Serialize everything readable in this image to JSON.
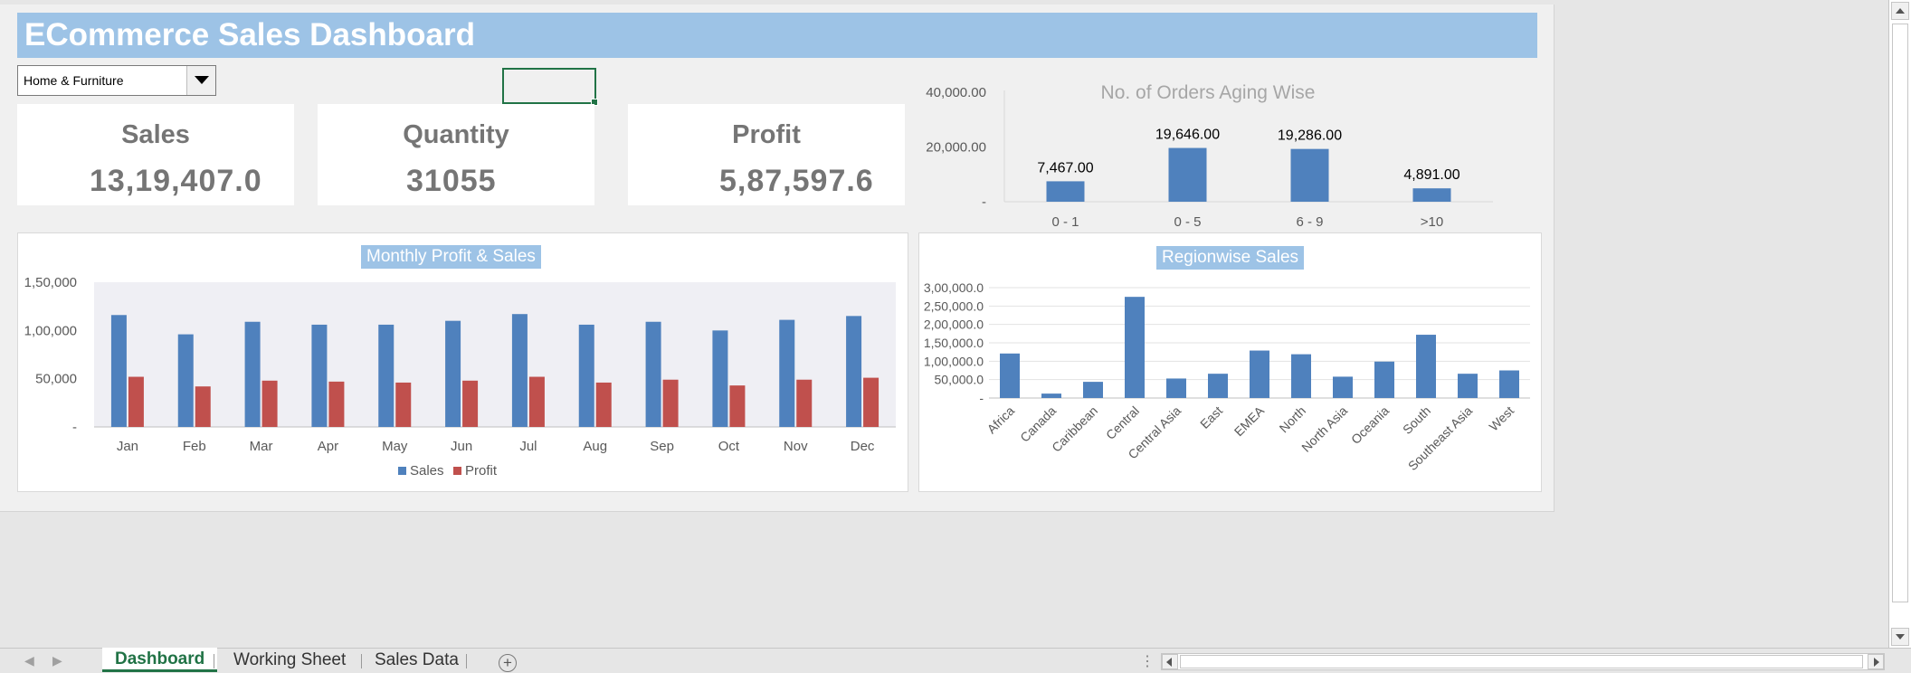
{
  "dashboard": {
    "title": "ECommerce Sales Dashboard",
    "filter": {
      "selected": "Home & Furniture"
    }
  },
  "kpis": [
    {
      "label": "Sales",
      "value": "13,19,407.0"
    },
    {
      "label": "Quantity",
      "value": "31055"
    },
    {
      "label": "Profit",
      "value": "5,87,597.6"
    }
  ],
  "colors": {
    "banner": "#9dc3e6",
    "sales": "#4f81bd",
    "profit": "#c0504d",
    "selection": "#217346"
  },
  "chart_data": [
    {
      "id": "aging",
      "type": "bar",
      "title": "No. of Orders Aging Wise",
      "categories": [
        "0 - 1",
        "0 - 5",
        "6 - 9",
        ">10"
      ],
      "values": [
        7467,
        19646,
        19286,
        4891
      ],
      "value_labels": [
        "7,467.00",
        "19,646.00",
        "19,286.00",
        "4,891.00"
      ],
      "y_ticks": [
        "-",
        "20,000.00",
        "40,000.00"
      ],
      "ylim": [
        0,
        40000
      ],
      "grid": false
    },
    {
      "id": "monthly",
      "type": "bar",
      "title": "Monthly Profit & Sales",
      "categories": [
        "Jan",
        "Feb",
        "Mar",
        "Apr",
        "May",
        "Jun",
        "Jul",
        "Aug",
        "Sep",
        "Oct",
        "Nov",
        "Dec"
      ],
      "series": [
        {
          "name": "Sales",
          "values": [
            116000,
            96000,
            109000,
            106000,
            106000,
            110000,
            117000,
            106000,
            109000,
            100000,
            111000,
            115000
          ]
        },
        {
          "name": "Profit",
          "values": [
            52000,
            42000,
            48000,
            47000,
            46000,
            48000,
            52000,
            46000,
            49000,
            43000,
            49000,
            51000
          ]
        }
      ],
      "y_ticks": [
        "-",
        "50,000",
        "1,00,000",
        "1,50,000"
      ],
      "ylim": [
        0,
        150000
      ],
      "legend": "bottom"
    },
    {
      "id": "region",
      "type": "bar",
      "title": "Regionwise Sales",
      "categories": [
        "Africa",
        "Canada",
        "Caribbean",
        "Central",
        "Central Asia",
        "East",
        "EMEA",
        "North",
        "North Asia",
        "Oceania",
        "South",
        "Southeast Asia",
        "West"
      ],
      "values": [
        121000,
        12000,
        44000,
        275000,
        53000,
        66000,
        129000,
        119000,
        58000,
        99000,
        172000,
        66000,
        75000
      ],
      "y_ticks": [
        "-",
        "50,000.0",
        "1,00,000.0",
        "1,50,000.0",
        "2,00,000.0",
        "2,50,000.0",
        "3,00,000.0"
      ],
      "ylim": [
        0,
        300000
      ],
      "grid": true
    }
  ],
  "sheet_tabs": {
    "tabs": [
      "Dashboard",
      "Working Sheet",
      "Sales Data"
    ],
    "active": "Dashboard",
    "add_symbol": "+",
    "dots": "⋮",
    "nav_prev": "◀",
    "nav_next": "▶"
  }
}
